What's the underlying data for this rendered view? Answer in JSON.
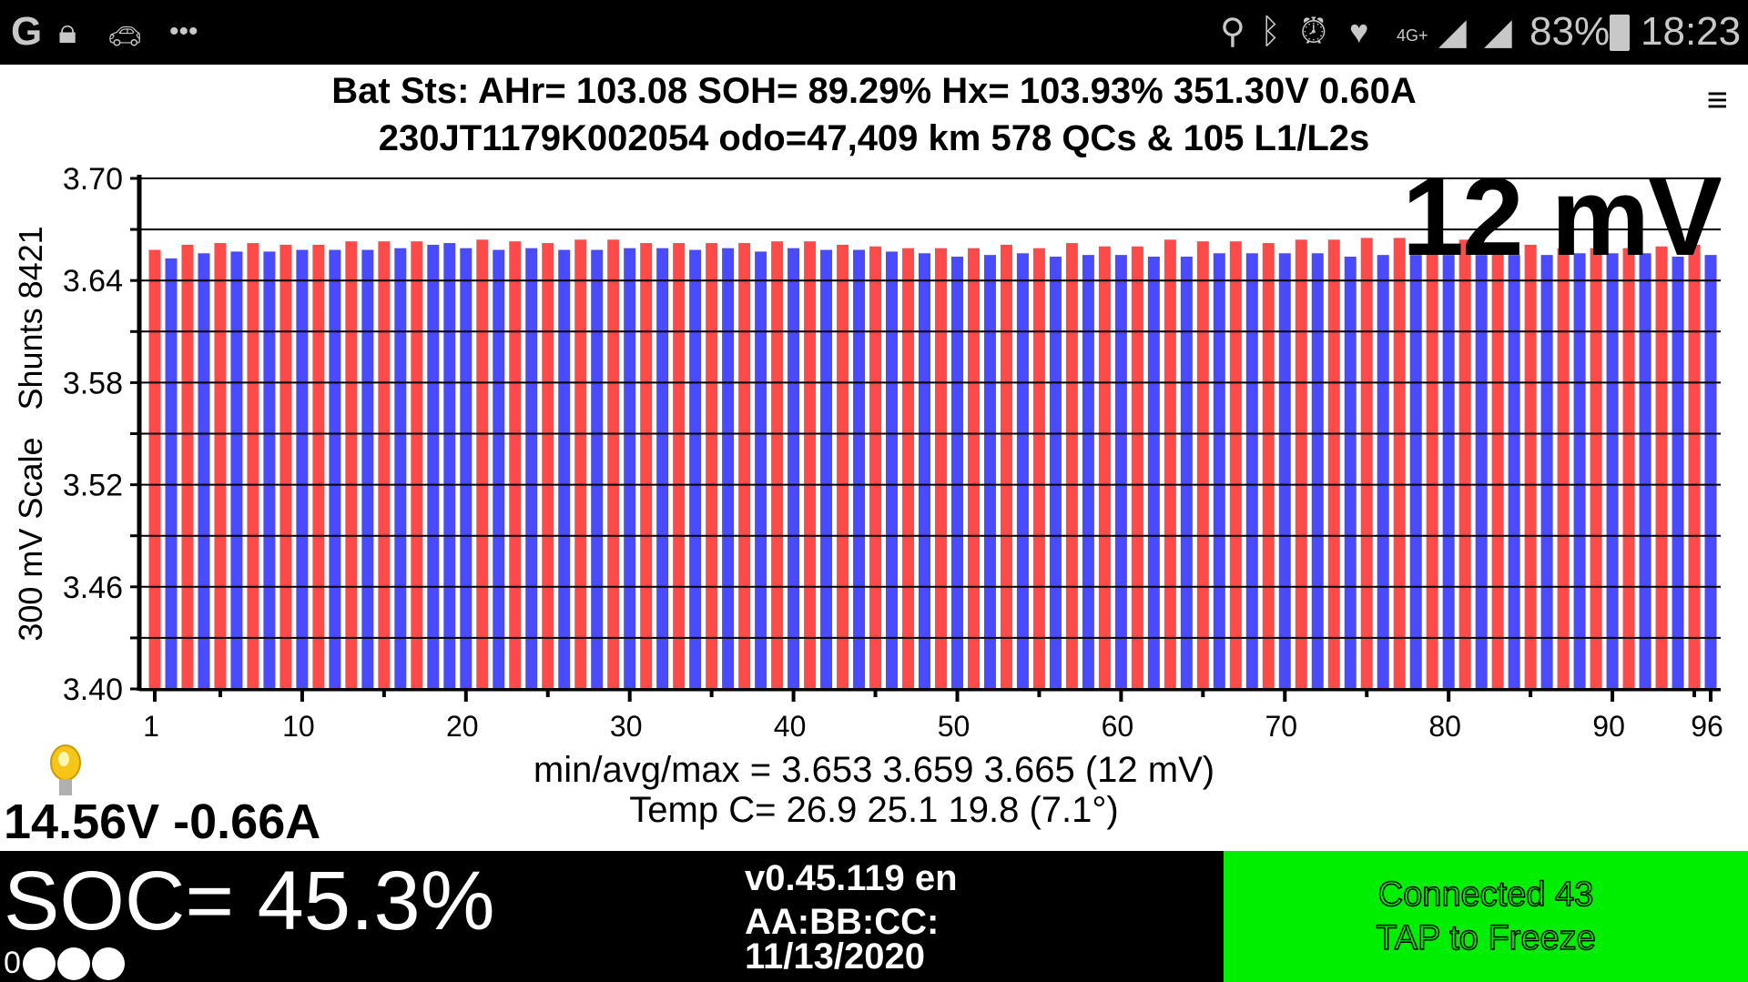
{
  "status_bar": {
    "left_icons": [
      "google-icon",
      "lock-icon",
      "car-icon",
      "more-dots-icon"
    ],
    "right_icons": [
      "location-icon",
      "bluetooth-icon",
      "alarm-icon",
      "heart-icon",
      "4g-plus-icon",
      "wifi-signal-icon",
      "cell-signal-icon"
    ],
    "network": "4G+",
    "battery": "83%",
    "time": "18:23"
  },
  "header": {
    "line1": "Bat Sts:  AHr= 103.08  SOH= 89.29%   Hx= 103.93%   351.30V 0.60A",
    "line2": "230JT1179K002054 odo=47,409 km  578 QCs & 105 L1/L2s",
    "menu_icon": "≡"
  },
  "spread_label": "12 mV",
  "chart_data": {
    "type": "bar",
    "ylabel": "300 mV Scale   Shunts 8421",
    "ylim": [
      3.4,
      3.7
    ],
    "yticks": [
      "3.70",
      "3.64",
      "3.58",
      "3.52",
      "3.46",
      "3.40"
    ],
    "xticks": [
      "1",
      "10",
      "20",
      "30",
      "40",
      "50",
      "60",
      "70",
      "80",
      "90",
      "96"
    ],
    "grid": true,
    "colors": {
      "r": "#ff4a4a",
      "b": "#4a4aff"
    },
    "values": [
      3.658,
      3.653,
      3.661,
      3.656,
      3.662,
      3.657,
      3.662,
      3.657,
      3.661,
      3.658,
      3.661,
      3.658,
      3.663,
      3.658,
      3.663,
      3.659,
      3.663,
      3.661,
      3.662,
      3.659,
      3.664,
      3.658,
      3.663,
      3.659,
      3.662,
      3.658,
      3.664,
      3.658,
      3.664,
      3.659,
      3.662,
      3.659,
      3.662,
      3.658,
      3.662,
      3.659,
      3.662,
      3.657,
      3.663,
      3.659,
      3.663,
      3.658,
      3.661,
      3.658,
      3.66,
      3.657,
      3.659,
      3.656,
      3.659,
      3.654,
      3.659,
      3.655,
      3.661,
      3.656,
      3.659,
      3.654,
      3.662,
      3.655,
      3.66,
      3.655,
      3.66,
      3.654,
      3.664,
      3.654,
      3.663,
      3.656,
      3.663,
      3.656,
      3.662,
      3.656,
      3.664,
      3.656,
      3.664,
      3.654,
      3.665,
      3.655,
      3.665,
      3.655,
      3.659,
      3.655,
      3.664,
      3.655,
      3.658,
      3.655,
      3.661,
      3.655,
      3.659,
      3.656,
      3.659,
      3.656,
      3.659,
      3.656,
      3.66,
      3.654,
      3.661,
      3.655
    ],
    "bar_colors": [
      "r",
      "b",
      "r",
      "b",
      "r",
      "b",
      "r",
      "b",
      "r",
      "b",
      "r",
      "b",
      "r",
      "b",
      "r",
      "b",
      "r",
      "b",
      "b",
      "b",
      "r",
      "b",
      "r",
      "b",
      "r",
      "b",
      "r",
      "b",
      "r",
      "b",
      "r",
      "b",
      "r",
      "b",
      "r",
      "b",
      "r",
      "b",
      "r",
      "b",
      "r",
      "b",
      "r",
      "b",
      "r",
      "b",
      "r",
      "b",
      "r",
      "b",
      "r",
      "b",
      "r",
      "b",
      "r",
      "b",
      "r",
      "b",
      "r",
      "b",
      "r",
      "b",
      "r",
      "b",
      "r",
      "b",
      "r",
      "b",
      "r",
      "b",
      "r",
      "b",
      "r",
      "b",
      "r",
      "b",
      "r",
      "b",
      "r",
      "b",
      "r",
      "b",
      "r",
      "b",
      "r",
      "b",
      "r",
      "b",
      "r",
      "b",
      "r",
      "b",
      "r",
      "b",
      "r",
      "b"
    ]
  },
  "stats": {
    "minavgmax": "min/avg/max = 3.653 3.659 3.665  (12 mV)",
    "temp": "Temp C= 26.9  25.1  19.8  (7.1°)"
  },
  "aux_battery": "14.56V -0.66A",
  "soc": "SOC= 45.3%",
  "soc_dots_label": "0",
  "version": {
    "line1": "v0.45.119 en",
    "line2": "AA:BB:CC:",
    "line3": "11/13/2020"
  },
  "connection": {
    "line1": "Connected 43",
    "line2": "TAP to Freeze",
    "color": "#00ef00"
  }
}
